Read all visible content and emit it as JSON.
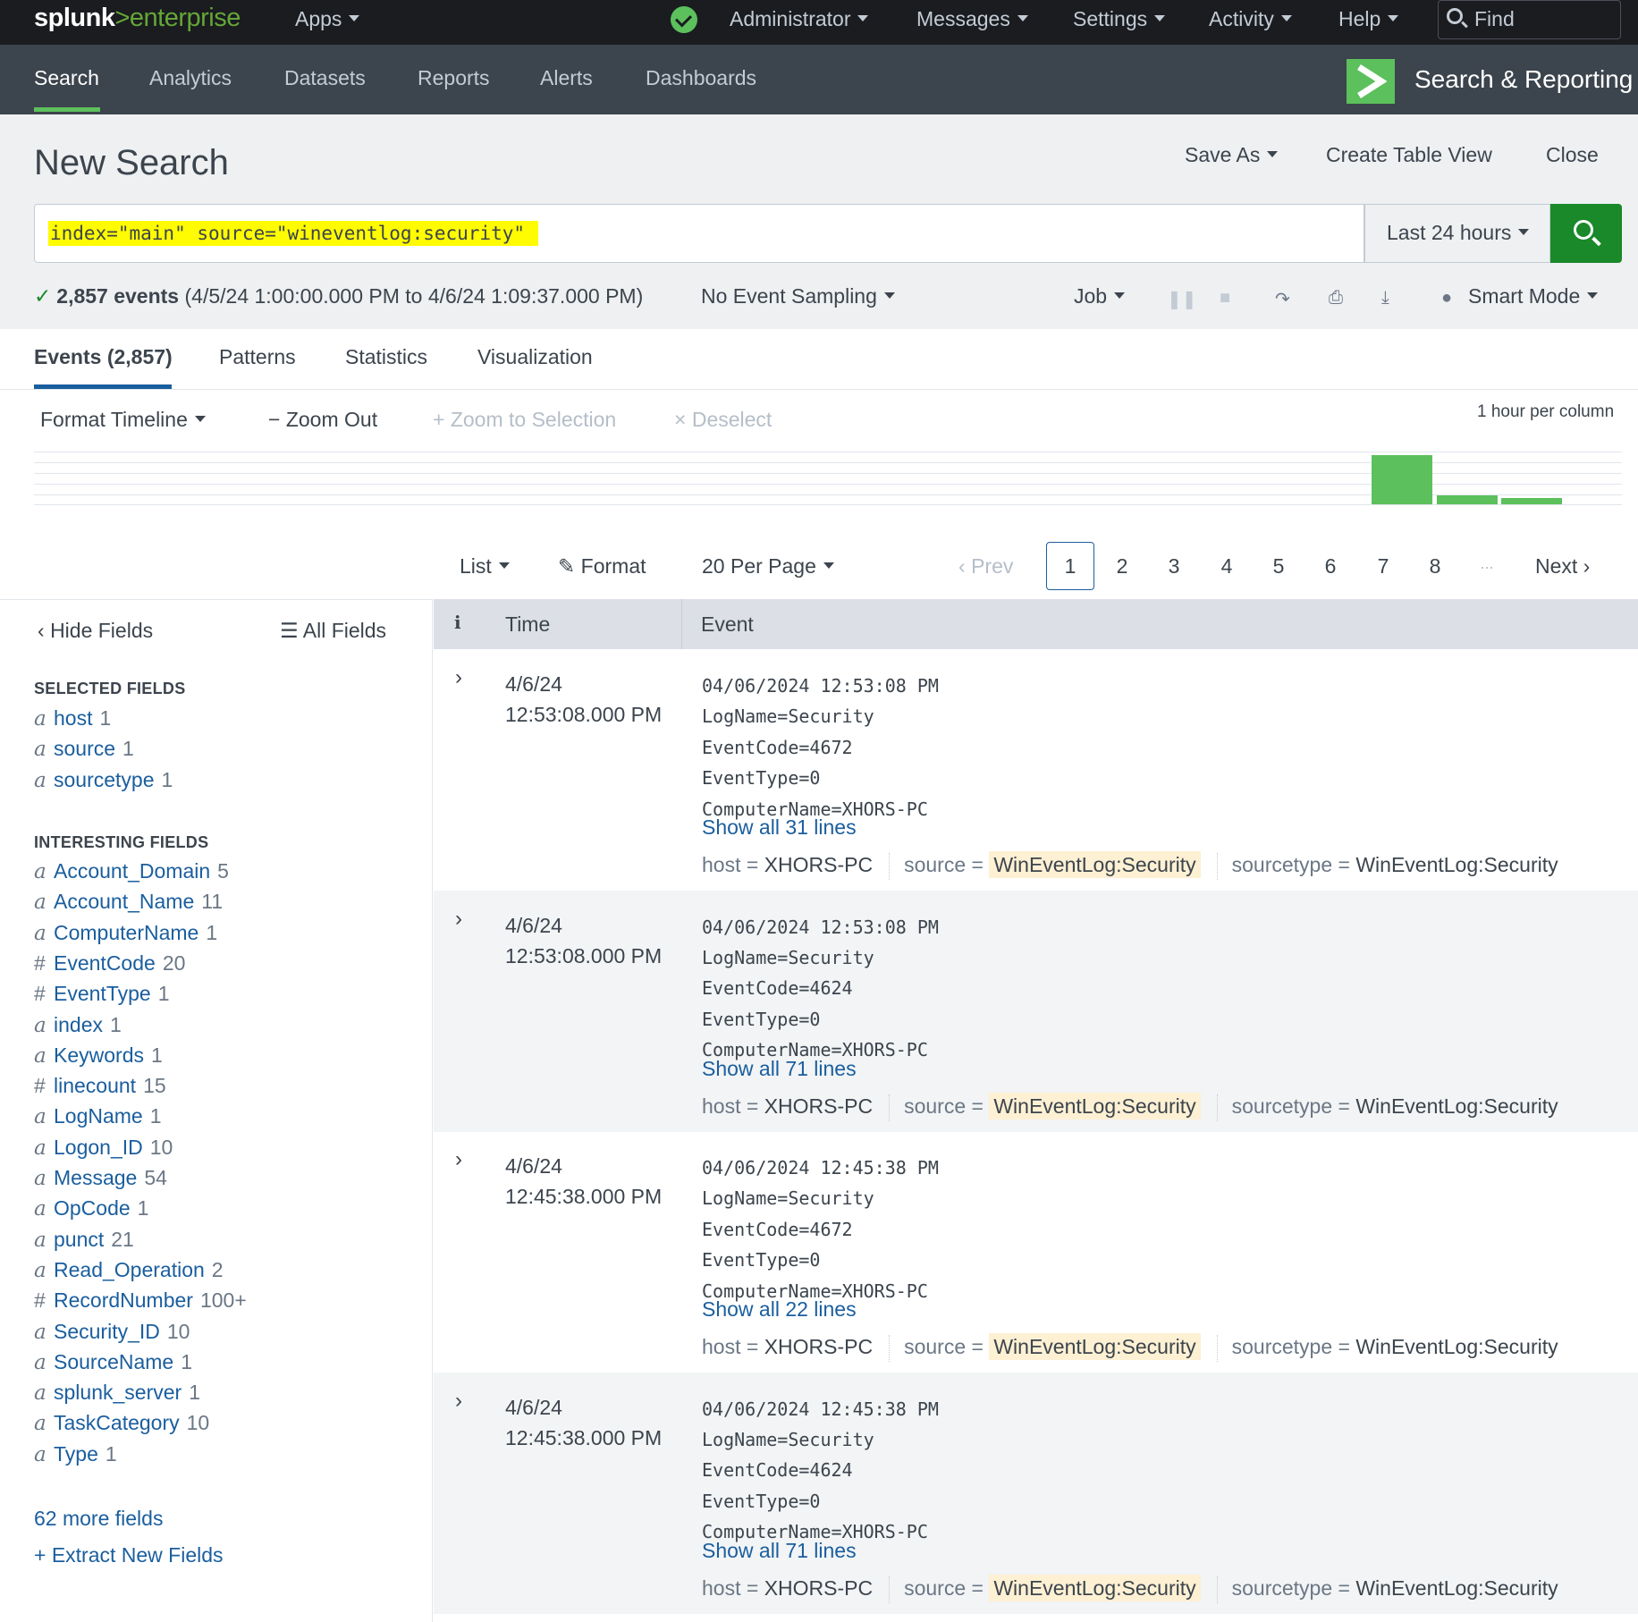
{
  "topbar": {
    "logo_main": "splunk",
    "logo_gt": ">",
    "logo_sub": "enterprise",
    "apps": "Apps",
    "administrator": "Administrator",
    "messages": "Messages",
    "settings": "Settings",
    "activity": "Activity",
    "help": "Help",
    "find": "Find"
  },
  "nav": {
    "items": [
      "Search",
      "Analytics",
      "Datasets",
      "Reports",
      "Alerts",
      "Dashboards"
    ],
    "app_title": "Search & Reporting"
  },
  "header": {
    "title": "New Search",
    "save_as": "Save As",
    "create_table_view": "Create Table View",
    "close": "Close"
  },
  "search": {
    "query": "index=\"main\" source=\"wineventlog:security\"",
    "time_range": "Last 24 hours"
  },
  "status": {
    "count": "2,857 events",
    "range": "(4/5/24 1:00:00.000 PM to 4/6/24 1:09:37.000 PM)",
    "sampling": "No Event Sampling",
    "job": "Job",
    "mode": "Smart Mode"
  },
  "tabs": [
    "Events (2,857)",
    "Patterns",
    "Statistics",
    "Visualization"
  ],
  "timeline": {
    "format": "Format Timeline",
    "zoom_out": "Zoom Out",
    "zoom_selection": "Zoom to Selection",
    "deselect": "Deselect",
    "per_column": "1 hour per column",
    "bars": [
      {
        "hour_index": 21,
        "value": 1.0
      },
      {
        "hour_index": 22,
        "value": 0.18
      },
      {
        "hour_index": 23,
        "value": 0.12
      }
    ]
  },
  "results": {
    "list": "List",
    "format": "Format",
    "per_page": "20 Per Page",
    "prev": "Prev",
    "pages": [
      "1",
      "2",
      "3",
      "4",
      "5",
      "6",
      "7",
      "8"
    ],
    "ellipsis": "...",
    "next": "Next"
  },
  "fields_panel": {
    "hide_fields": "Hide Fields",
    "all_fields": "All Fields",
    "selected_heading": "SELECTED FIELDS",
    "selected": [
      {
        "type": "a",
        "name": "host",
        "count": "1"
      },
      {
        "type": "a",
        "name": "source",
        "count": "1"
      },
      {
        "type": "a",
        "name": "sourcetype",
        "count": "1"
      }
    ],
    "interesting_heading": "INTERESTING FIELDS",
    "interesting": [
      {
        "type": "a",
        "name": "Account_Domain",
        "count": "5"
      },
      {
        "type": "a",
        "name": "Account_Name",
        "count": "11"
      },
      {
        "type": "a",
        "name": "ComputerName",
        "count": "1"
      },
      {
        "type": "#",
        "name": "EventCode",
        "count": "20"
      },
      {
        "type": "#",
        "name": "EventType",
        "count": "1"
      },
      {
        "type": "a",
        "name": "index",
        "count": "1"
      },
      {
        "type": "a",
        "name": "Keywords",
        "count": "1"
      },
      {
        "type": "#",
        "name": "linecount",
        "count": "15"
      },
      {
        "type": "a",
        "name": "LogName",
        "count": "1"
      },
      {
        "type": "a",
        "name": "Logon_ID",
        "count": "10"
      },
      {
        "type": "a",
        "name": "Message",
        "count": "54"
      },
      {
        "type": "a",
        "name": "OpCode",
        "count": "1"
      },
      {
        "type": "a",
        "name": "punct",
        "count": "21"
      },
      {
        "type": "a",
        "name": "Read_Operation",
        "count": "2"
      },
      {
        "type": "#",
        "name": "RecordNumber",
        "count": "100+"
      },
      {
        "type": "a",
        "name": "Security_ID",
        "count": "10"
      },
      {
        "type": "a",
        "name": "SourceName",
        "count": "1"
      },
      {
        "type": "a",
        "name": "splunk_server",
        "count": "1"
      },
      {
        "type": "a",
        "name": "TaskCategory",
        "count": "10"
      },
      {
        "type": "a",
        "name": "Type",
        "count": "1"
      }
    ],
    "more_fields": "62 more fields",
    "extract": "+ Extract New Fields"
  },
  "table": {
    "col_info": "i",
    "col_time": "Time",
    "col_event": "Event",
    "meta_host_key": "host =",
    "meta_source_key": "source =",
    "meta_sourcetype_key": "sourcetype =",
    "events": [
      {
        "date": "4/6/24",
        "time": "12:53:08.000 PM",
        "lines": [
          "04/06/2024 12:53:08 PM",
          "LogName=Security",
          "EventCode=4672",
          "EventType=0",
          "ComputerName=XHORS-PC"
        ],
        "show_all": "Show all 31 lines",
        "host": "XHORS-PC",
        "source": "WinEventLog:Security",
        "sourcetype": "WinEventLog:Security"
      },
      {
        "date": "4/6/24",
        "time": "12:53:08.000 PM",
        "lines": [
          "04/06/2024 12:53:08 PM",
          "LogName=Security",
          "EventCode=4624",
          "EventType=0",
          "ComputerName=XHORS-PC"
        ],
        "show_all": "Show all 71 lines",
        "host": "XHORS-PC",
        "source": "WinEventLog:Security",
        "sourcetype": "WinEventLog:Security"
      },
      {
        "date": "4/6/24",
        "time": "12:45:38.000 PM",
        "lines": [
          "04/06/2024 12:45:38 PM",
          "LogName=Security",
          "EventCode=4672",
          "EventType=0",
          "ComputerName=XHORS-PC"
        ],
        "show_all": "Show all 22 lines",
        "host": "XHORS-PC",
        "source": "WinEventLog:Security",
        "sourcetype": "WinEventLog:Security"
      },
      {
        "date": "4/6/24",
        "time": "12:45:38.000 PM",
        "lines": [
          "04/06/2024 12:45:38 PM",
          "LogName=Security",
          "EventCode=4624",
          "EventType=0",
          "ComputerName=XHORS-PC"
        ],
        "show_all": "Show all 71 lines",
        "host": "XHORS-PC",
        "source": "WinEventLog:Security",
        "sourcetype": "WinEventLog:Security"
      }
    ]
  },
  "colors": {
    "brand_green": "#5cc05c",
    "search_button": "#1a8929",
    "link_blue": "#1a5e9e",
    "topbar": "#1a1c20",
    "navbar": "#3c444d"
  }
}
